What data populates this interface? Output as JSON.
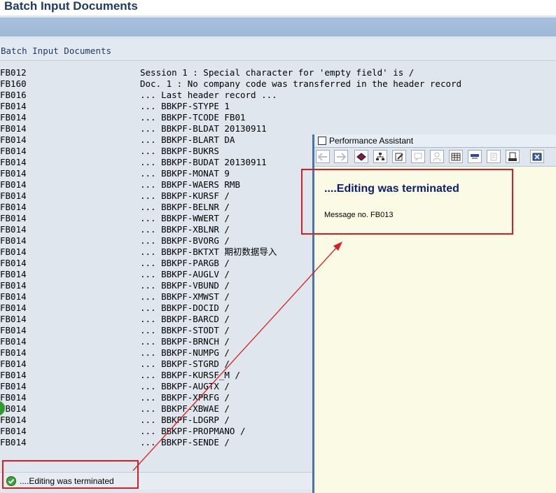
{
  "window": {
    "title": "Batch Input Documents"
  },
  "subheader": {
    "title": "Batch Input Documents"
  },
  "log": [
    {
      "code": "FB012",
      "message": "Session 1 : Special character for 'empty field' is /"
    },
    {
      "code": "FB160",
      "message": "Doc. 1 : No company code was transferred in the header record"
    },
    {
      "code": "FB016",
      "message": "... Last header record ..."
    },
    {
      "code": "FB014",
      "message": "... BBKPF-STYPE 1"
    },
    {
      "code": "FB014",
      "message": "... BBKPF-TCODE FB01"
    },
    {
      "code": "FB014",
      "message": "... BBKPF-BLDAT 20130911"
    },
    {
      "code": "FB014",
      "message": "... BBKPF-BLART DA"
    },
    {
      "code": "FB014",
      "message": "... BBKPF-BUKRS"
    },
    {
      "code": "FB014",
      "message": "... BBKPF-BUDAT 20130911"
    },
    {
      "code": "FB014",
      "message": "... BBKPF-MONAT 9"
    },
    {
      "code": "FB014",
      "message": "... BBKPF-WAERS RMB"
    },
    {
      "code": "FB014",
      "message": "... BBKPF-KURSF /"
    },
    {
      "code": "FB014",
      "message": "... BBKPF-BELNR /"
    },
    {
      "code": "FB014",
      "message": "... BBKPF-WWERT /"
    },
    {
      "code": "FB014",
      "message": "... BBKPF-XBLNR /"
    },
    {
      "code": "FB014",
      "message": "... BBKPF-BVORG /"
    },
    {
      "code": "FB014",
      "message": "... BBKPF-BKTXT 期初数据导入"
    },
    {
      "code": "FB014",
      "message": "... BBKPF-PARGB /"
    },
    {
      "code": "FB014",
      "message": "... BBKPF-AUGLV /"
    },
    {
      "code": "FB014",
      "message": "... BBKPF-VBUND /"
    },
    {
      "code": "FB014",
      "message": "... BBKPF-XMWST /"
    },
    {
      "code": "FB014",
      "message": "... BBKPF-DOCID /"
    },
    {
      "code": "FB014",
      "message": "... BBKPF-BARCD /"
    },
    {
      "code": "FB014",
      "message": "... BBKPF-STODT /"
    },
    {
      "code": "FB014",
      "message": "... BBKPF-BRNCH /"
    },
    {
      "code": "FB014",
      "message": "... BBKPF-NUMPG /"
    },
    {
      "code": "FB014",
      "message": "... BBKPF-STGRD /"
    },
    {
      "code": "FB014",
      "message": "... BBKPF-KURSF_M /"
    },
    {
      "code": "FB014",
      "message": "... BBKPF-AUGTX /"
    },
    {
      "code": "FB014",
      "message": "... BBKPF-XPRFG /"
    },
    {
      "code": "FB014",
      "message": "... BBKPF-XBWAE /"
    },
    {
      "code": "FB014",
      "message": "... BBKPF-LDGRP /"
    },
    {
      "code": "FB014",
      "message": "... BBKPF-PROPMANO /"
    },
    {
      "code": "FB014",
      "message": "... BBKPF-SENDE /"
    }
  ],
  "status_bar": {
    "message": "....Editing was terminated",
    "icon": "success-check-icon",
    "status_color": "#3da23d"
  },
  "performance_assistant": {
    "title": "Performance Assistant",
    "heading": "....Editing was terminated",
    "message_number": "Message no. FB013",
    "toolbar_icons": [
      "back-arrow-icon",
      "forward-arrow-icon",
      "book-icon",
      "structure-icon",
      "edit-icon",
      "annotation-icon",
      "person-icon",
      "table-icon",
      "flag-icon",
      "settings-icon",
      "print-icon",
      "close-icon"
    ]
  },
  "colors": {
    "highlight": "#d81e1e",
    "heading": "#0c1f6b",
    "title": "#1e3b63",
    "toolbar": "#a9c1dd"
  }
}
